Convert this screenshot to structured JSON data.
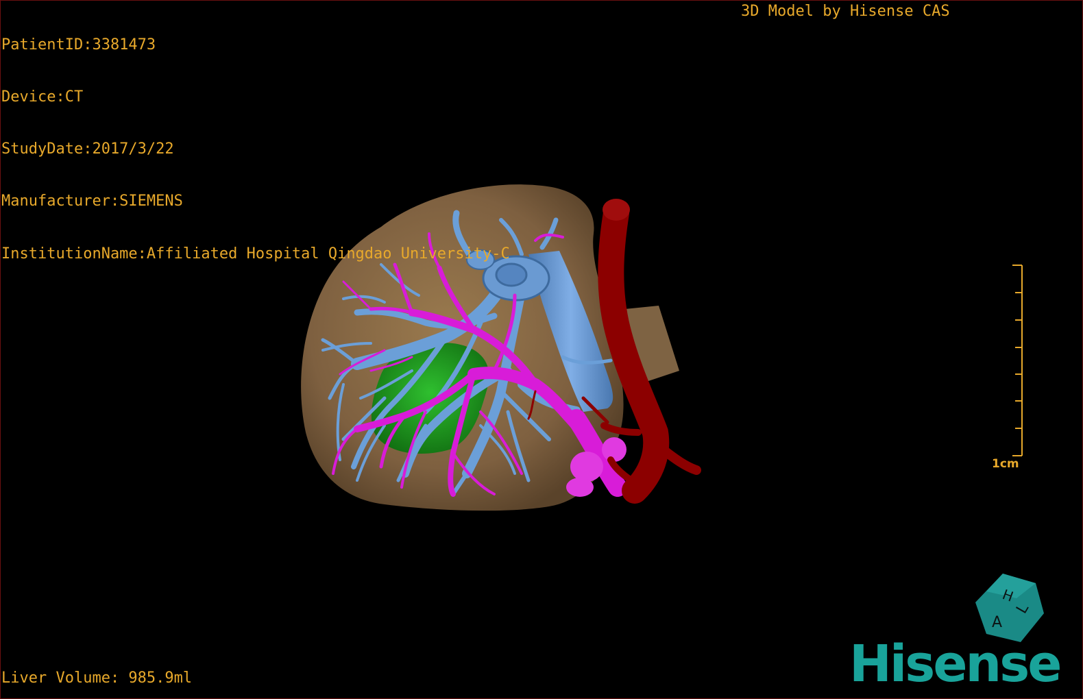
{
  "patient_info": {
    "patient_id": "PatientID:3381473",
    "device": "Device:CT",
    "study_date": "StudyDate:2017/3/22",
    "manufacturer": "Manufacturer:SIEMENS",
    "institution": "InstitutionName:Affiliated Hospital Qingdao University-C"
  },
  "model_credit": "3D Model by Hisense CAS",
  "liver_volume": "Liver Volume: 985.9ml",
  "scale": {
    "label": "1cm"
  },
  "orientation_cube": {
    "labels": [
      "H",
      "A",
      "L"
    ],
    "color": "#1a8a86"
  },
  "brand": "Hisense",
  "colors": {
    "overlay_text": "#e8a92b",
    "liver": "#8a6b43",
    "hepatic_vein": "#6b9fd8",
    "portal_vein": "#d81cd8",
    "tumor": "#1f9a1f",
    "artery": "#8c0000",
    "brand": "#19a39a"
  }
}
